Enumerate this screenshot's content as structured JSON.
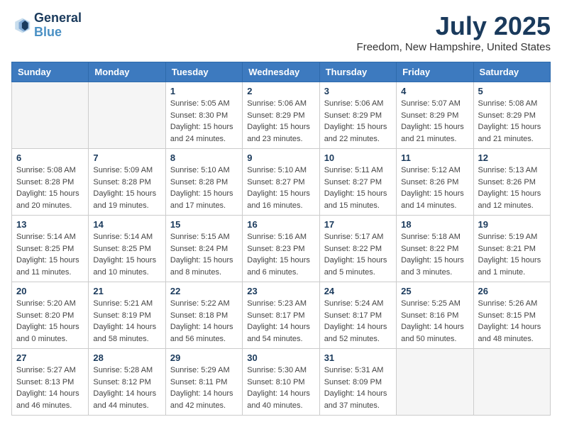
{
  "header": {
    "logo_line1": "General",
    "logo_line2": "Blue",
    "title": "July 2025",
    "subtitle": "Freedom, New Hampshire, United States"
  },
  "weekdays": [
    "Sunday",
    "Monday",
    "Tuesday",
    "Wednesday",
    "Thursday",
    "Friday",
    "Saturday"
  ],
  "weeks": [
    [
      {
        "day": "",
        "info": ""
      },
      {
        "day": "",
        "info": ""
      },
      {
        "day": "1",
        "info": "Sunrise: 5:05 AM\nSunset: 8:30 PM\nDaylight: 15 hours and 24 minutes."
      },
      {
        "day": "2",
        "info": "Sunrise: 5:06 AM\nSunset: 8:29 PM\nDaylight: 15 hours and 23 minutes."
      },
      {
        "day": "3",
        "info": "Sunrise: 5:06 AM\nSunset: 8:29 PM\nDaylight: 15 hours and 22 minutes."
      },
      {
        "day": "4",
        "info": "Sunrise: 5:07 AM\nSunset: 8:29 PM\nDaylight: 15 hours and 21 minutes."
      },
      {
        "day": "5",
        "info": "Sunrise: 5:08 AM\nSunset: 8:29 PM\nDaylight: 15 hours and 21 minutes."
      }
    ],
    [
      {
        "day": "6",
        "info": "Sunrise: 5:08 AM\nSunset: 8:28 PM\nDaylight: 15 hours and 20 minutes."
      },
      {
        "day": "7",
        "info": "Sunrise: 5:09 AM\nSunset: 8:28 PM\nDaylight: 15 hours and 19 minutes."
      },
      {
        "day": "8",
        "info": "Sunrise: 5:10 AM\nSunset: 8:28 PM\nDaylight: 15 hours and 17 minutes."
      },
      {
        "day": "9",
        "info": "Sunrise: 5:10 AM\nSunset: 8:27 PM\nDaylight: 15 hours and 16 minutes."
      },
      {
        "day": "10",
        "info": "Sunrise: 5:11 AM\nSunset: 8:27 PM\nDaylight: 15 hours and 15 minutes."
      },
      {
        "day": "11",
        "info": "Sunrise: 5:12 AM\nSunset: 8:26 PM\nDaylight: 15 hours and 14 minutes."
      },
      {
        "day": "12",
        "info": "Sunrise: 5:13 AM\nSunset: 8:26 PM\nDaylight: 15 hours and 12 minutes."
      }
    ],
    [
      {
        "day": "13",
        "info": "Sunrise: 5:14 AM\nSunset: 8:25 PM\nDaylight: 15 hours and 11 minutes."
      },
      {
        "day": "14",
        "info": "Sunrise: 5:14 AM\nSunset: 8:25 PM\nDaylight: 15 hours and 10 minutes."
      },
      {
        "day": "15",
        "info": "Sunrise: 5:15 AM\nSunset: 8:24 PM\nDaylight: 15 hours and 8 minutes."
      },
      {
        "day": "16",
        "info": "Sunrise: 5:16 AM\nSunset: 8:23 PM\nDaylight: 15 hours and 6 minutes."
      },
      {
        "day": "17",
        "info": "Sunrise: 5:17 AM\nSunset: 8:22 PM\nDaylight: 15 hours and 5 minutes."
      },
      {
        "day": "18",
        "info": "Sunrise: 5:18 AM\nSunset: 8:22 PM\nDaylight: 15 hours and 3 minutes."
      },
      {
        "day": "19",
        "info": "Sunrise: 5:19 AM\nSunset: 8:21 PM\nDaylight: 15 hours and 1 minute."
      }
    ],
    [
      {
        "day": "20",
        "info": "Sunrise: 5:20 AM\nSunset: 8:20 PM\nDaylight: 15 hours and 0 minutes."
      },
      {
        "day": "21",
        "info": "Sunrise: 5:21 AM\nSunset: 8:19 PM\nDaylight: 14 hours and 58 minutes."
      },
      {
        "day": "22",
        "info": "Sunrise: 5:22 AM\nSunset: 8:18 PM\nDaylight: 14 hours and 56 minutes."
      },
      {
        "day": "23",
        "info": "Sunrise: 5:23 AM\nSunset: 8:17 PM\nDaylight: 14 hours and 54 minutes."
      },
      {
        "day": "24",
        "info": "Sunrise: 5:24 AM\nSunset: 8:17 PM\nDaylight: 14 hours and 52 minutes."
      },
      {
        "day": "25",
        "info": "Sunrise: 5:25 AM\nSunset: 8:16 PM\nDaylight: 14 hours and 50 minutes."
      },
      {
        "day": "26",
        "info": "Sunrise: 5:26 AM\nSunset: 8:15 PM\nDaylight: 14 hours and 48 minutes."
      }
    ],
    [
      {
        "day": "27",
        "info": "Sunrise: 5:27 AM\nSunset: 8:13 PM\nDaylight: 14 hours and 46 minutes."
      },
      {
        "day": "28",
        "info": "Sunrise: 5:28 AM\nSunset: 8:12 PM\nDaylight: 14 hours and 44 minutes."
      },
      {
        "day": "29",
        "info": "Sunrise: 5:29 AM\nSunset: 8:11 PM\nDaylight: 14 hours and 42 minutes."
      },
      {
        "day": "30",
        "info": "Sunrise: 5:30 AM\nSunset: 8:10 PM\nDaylight: 14 hours and 40 minutes."
      },
      {
        "day": "31",
        "info": "Sunrise: 5:31 AM\nSunset: 8:09 PM\nDaylight: 14 hours and 37 minutes."
      },
      {
        "day": "",
        "info": ""
      },
      {
        "day": "",
        "info": ""
      }
    ]
  ]
}
